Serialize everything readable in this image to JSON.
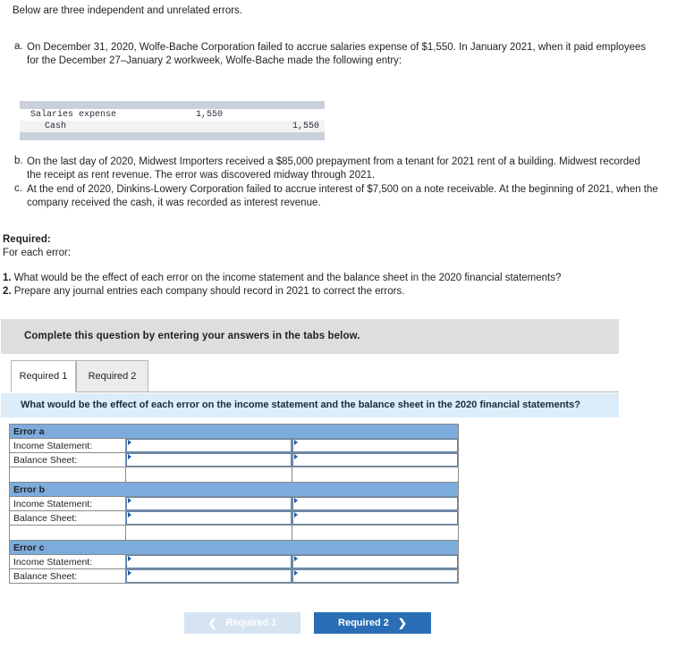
{
  "intro": "Below are three independent and unrelated errors.",
  "items": [
    {
      "marker": "a.",
      "text": "On December 31, 2020, Wolfe-Bache Corporation failed to accrue salaries expense of $1,550. In January 2021, when it paid employees for the December 27–January 2 workweek, Wolfe-Bache made the following entry:"
    },
    {
      "marker": "b.",
      "text": "On the last day of 2020, Midwest Importers received a $85,000 prepayment from a tenant for 2021 rent of a building. Midwest recorded the receipt as rent revenue. The error was discovered midway through 2021."
    },
    {
      "marker": "c.",
      "text": "At the end of 2020, Dinkins-Lowery Corporation failed to accrue interest of $7,500 on a note receivable. At the beginning of 2021, when the company received the cash, it was recorded as interest revenue."
    }
  ],
  "journal": {
    "rows": [
      {
        "account": "Salaries expense",
        "indent": false,
        "debit": "1,550",
        "credit": ""
      },
      {
        "account": "Cash",
        "indent": true,
        "debit": "",
        "credit": "1,550"
      }
    ]
  },
  "required": {
    "heading": "Required:",
    "subheading": "For each error:",
    "items": [
      {
        "number": "1.",
        "text": " What would be the effect of each error on the income statement and the balance sheet in the 2020 financial statements?"
      },
      {
        "number": "2.",
        "text": " Prepare any journal entries each company should record in 2021 to correct the errors."
      }
    ]
  },
  "instruction_band": {
    "text": "Complete this question by entering your answers in the tabs below."
  },
  "tabs": [
    {
      "label": "Required 1",
      "active": true
    },
    {
      "label": "Required 2",
      "active": false
    }
  ],
  "question_band": {
    "text": "What would be the effect of each error on the income statement and the balance sheet in the 2020 financial statements?"
  },
  "answer_grid": {
    "sections": [
      {
        "title": "Error a",
        "rows": [
          {
            "label": "Income Statement:",
            "col2": "",
            "col3": ""
          },
          {
            "label": "Balance Sheet:",
            "col2": "",
            "col3": ""
          }
        ],
        "has_blank_row": true
      },
      {
        "title": "Error b",
        "rows": [
          {
            "label": "Income Statement:",
            "col2": "",
            "col3": ""
          },
          {
            "label": "Balance Sheet:",
            "col2": "",
            "col3": ""
          }
        ],
        "has_blank_row": true
      },
      {
        "title": "Error c",
        "rows": [
          {
            "label": "Income Statement:",
            "col2": "",
            "col3": ""
          },
          {
            "label": "Balance Sheet:",
            "col2": "",
            "col3": ""
          }
        ],
        "has_blank_row": false
      }
    ]
  },
  "nav": {
    "prev_label": "Required 1",
    "prev_icon": "chevron-left",
    "next_label": "Required 2",
    "next_icon": "chevron-right"
  },
  "colors": {
    "section_header": "#7cabdd",
    "question_band": "#dcedf9",
    "instruction_band": "#dedede",
    "next_button": "#2a6db5",
    "prev_button": "#d6e4f2"
  }
}
